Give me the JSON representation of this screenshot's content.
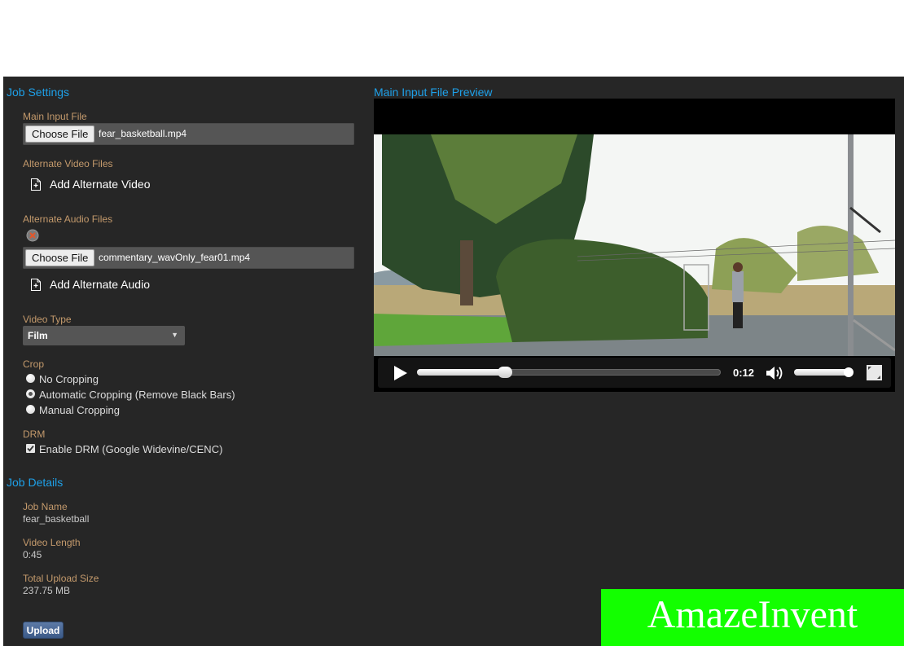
{
  "job_settings": {
    "title": "Job Settings",
    "main_input": {
      "label": "Main Input File",
      "button": "Choose File",
      "file": "fear_basketball.mp4"
    },
    "alt_video": {
      "label": "Alternate Video Files",
      "add_label": "Add Alternate Video"
    },
    "alt_audio": {
      "label": "Alternate Audio Files",
      "button": "Choose File",
      "file": "commentary_wavOnly_fear01.mp4",
      "add_label": "Add Alternate Audio"
    },
    "video_type": {
      "label": "Video Type",
      "selected": "Film",
      "arrow": "▼"
    },
    "crop": {
      "label": "Crop",
      "options": [
        {
          "label": "No Cropping",
          "checked": false
        },
        {
          "label": "Automatic Cropping (Remove Black Bars)",
          "checked": true
        },
        {
          "label": "Manual Cropping",
          "checked": false
        }
      ]
    },
    "drm": {
      "label": "DRM",
      "checkbox_label": "Enable DRM (Google Widevine/CENC)",
      "checked": true
    }
  },
  "job_details": {
    "title": "Job Details",
    "job_name_label": "Job Name",
    "job_name": "fear_basketball",
    "length_label": "Video Length",
    "length": "0:45",
    "size_label": "Total Upload Size",
    "size": "237.75 MB",
    "upload_button": "Upload"
  },
  "preview": {
    "title": "Main Input File Preview",
    "current_time": "0:12",
    "progress_fraction": 0.29,
    "volume_fraction": 0.95
  },
  "brand": {
    "text": "AmazeInvent",
    "color": "#13ff00"
  },
  "colors": {
    "accent": "#1ea0e8",
    "label": "#c49a6c",
    "panel": "#262626"
  }
}
